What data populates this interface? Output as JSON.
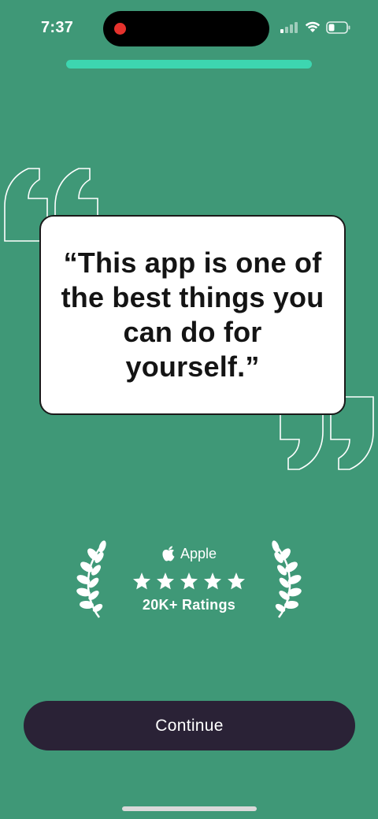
{
  "status_bar": {
    "time": "7:37",
    "icons": [
      "cellular-signal-icon",
      "wifi-icon",
      "battery-icon"
    ],
    "recording_indicator_color": "#e5322d"
  },
  "progress": {
    "fraction": 1.0,
    "color": "#3dd6b0"
  },
  "quote": {
    "text": "“This app is one of the best things you can do for yourself.”"
  },
  "rating": {
    "source_label": "Apple",
    "stars": 5,
    "ratings_label": "20K+ Ratings"
  },
  "footer": {
    "continue_label": "Continue"
  },
  "colors": {
    "background": "#3f9877",
    "card": "#ffffff",
    "button": "#2a2236",
    "text_light": "#ffffff",
    "text_dark": "#141414"
  }
}
